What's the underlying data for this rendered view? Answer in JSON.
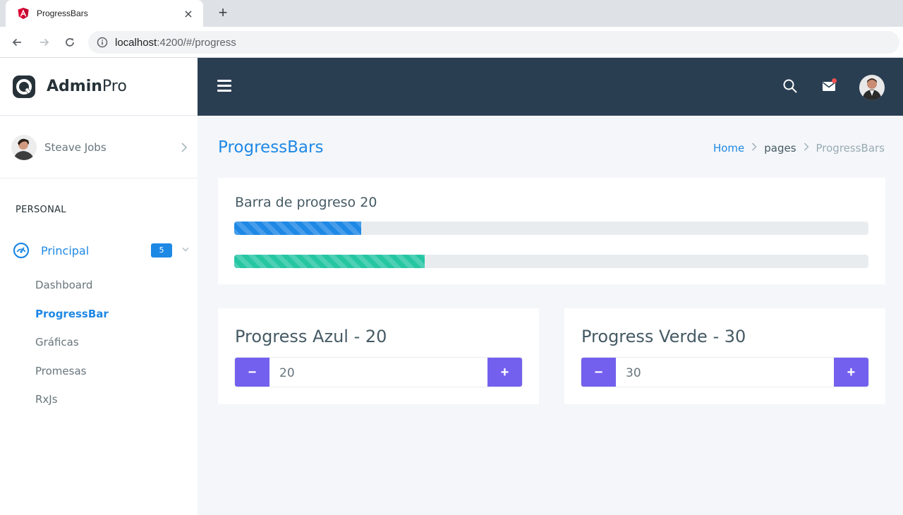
{
  "browser": {
    "tab_title": "ProgressBars",
    "close_symbol": "×",
    "new_tab_symbol": "+",
    "url_host": "localhost",
    "url_path": ":4200/#/progress"
  },
  "brand": {
    "bold": "Admin",
    "light": "Pro"
  },
  "sidebar": {
    "user_name": "Steave Jobs",
    "section_label": "PERSONAL",
    "menu_label": "Principal",
    "badge": "5",
    "items": [
      {
        "label": "Dashboard"
      },
      {
        "label": "ProgressBar"
      },
      {
        "label": "Gráficas"
      },
      {
        "label": "Promesas"
      },
      {
        "label": "RxJs"
      }
    ]
  },
  "page": {
    "title": "ProgressBars",
    "breadcrumb": {
      "home": "Home",
      "pages": "pages",
      "current": "ProgressBars"
    }
  },
  "progress_card": {
    "title": "Barra de progreso 20",
    "bars": [
      {
        "name": "azul",
        "percent": 20,
        "color": "#1e88e5"
      },
      {
        "name": "verde",
        "percent": 30,
        "color": "#26c6a3"
      }
    ]
  },
  "controls": {
    "azul": {
      "title": "Progress Azul - 20",
      "value": "20",
      "minus": "−",
      "plus": "+"
    },
    "verde": {
      "title": "Progress Verde - 30",
      "value": "30",
      "minus": "−",
      "plus": "+"
    }
  },
  "colors": {
    "accent": "#1e88e5",
    "topbar": "#2a3e52",
    "button": "#7460ee"
  },
  "icons": {
    "tab_favicon": "angular-icon",
    "brand_logo": "adminpro-logo-icon",
    "menu": "hamburger-icon",
    "search": "search-icon",
    "mail": "mail-icon",
    "principal": "gauge-icon"
  }
}
